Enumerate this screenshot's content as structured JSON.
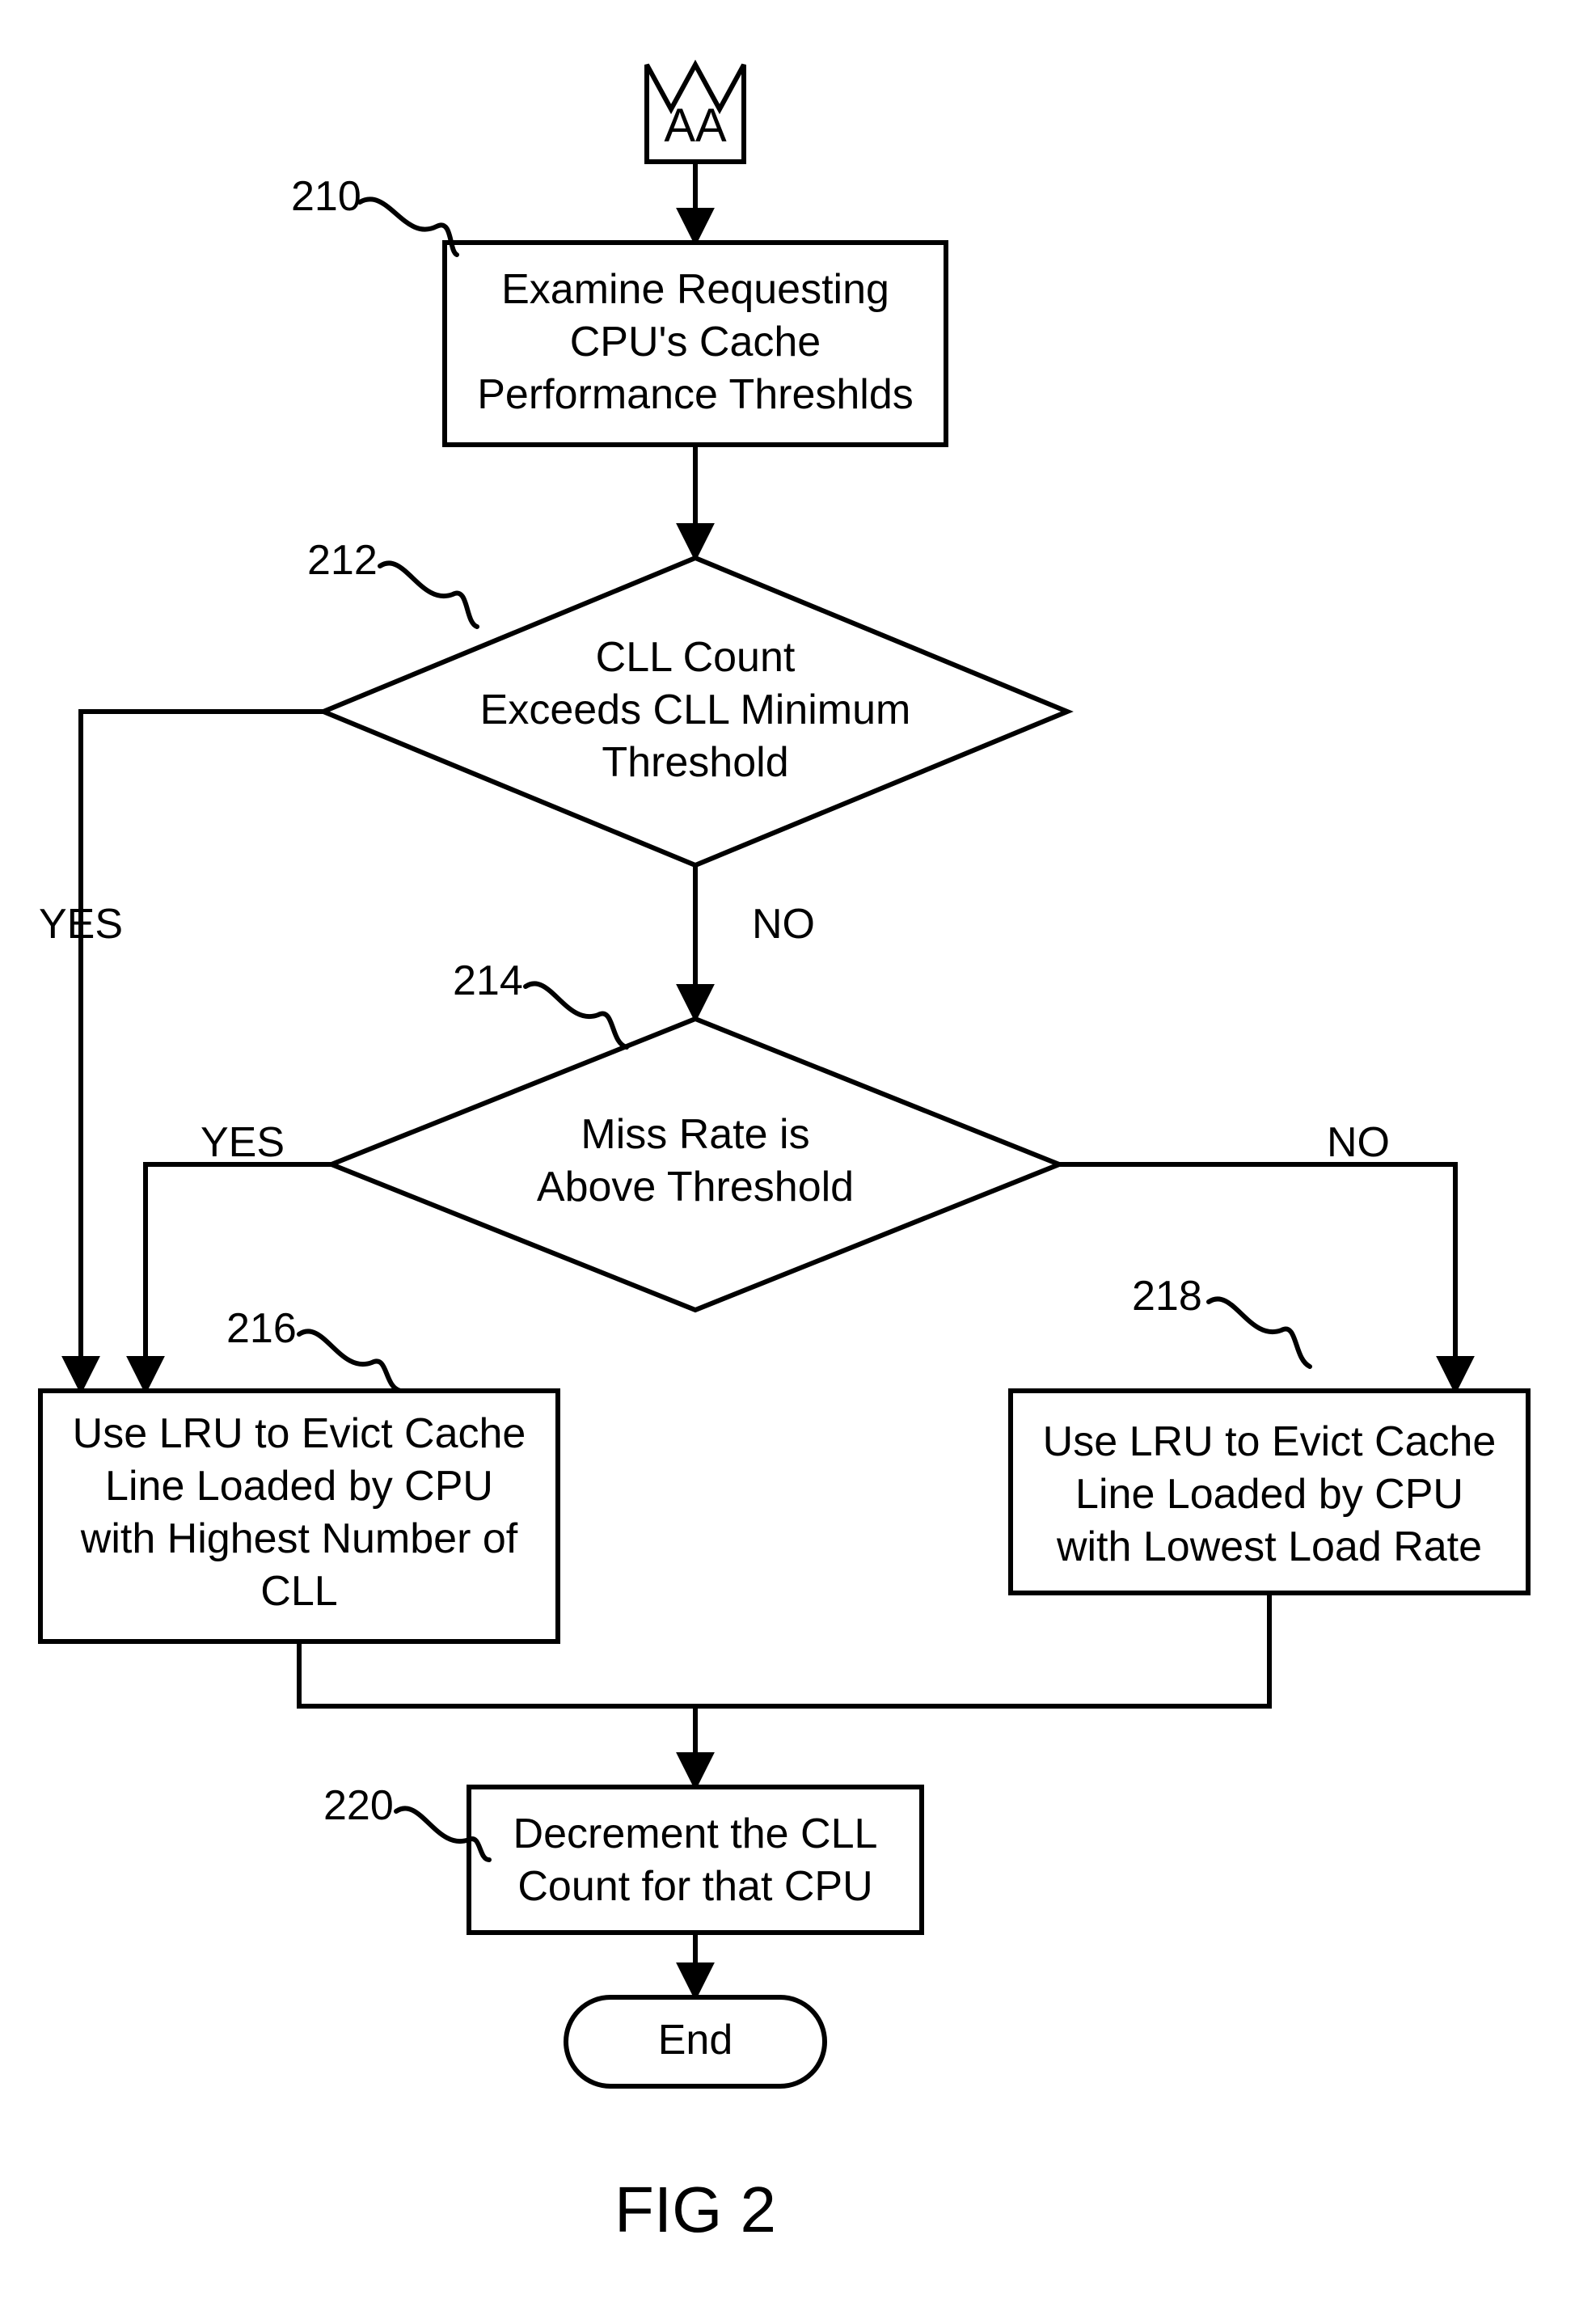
{
  "connector": {
    "label": "AA"
  },
  "refs": {
    "r210": "210",
    "r212": "212",
    "r214": "214",
    "r216": "216",
    "r218": "218",
    "r220": "220"
  },
  "nodes": {
    "n210": {
      "l1": "Examine Requesting",
      "l2": "CPU's Cache",
      "l3": "Performance Threshlds"
    },
    "n212": {
      "l1": "CLL Count",
      "l2": "Exceeds CLL Minimum",
      "l3": "Threshold"
    },
    "n214": {
      "l1": "Miss Rate is",
      "l2": "Above Threshold"
    },
    "n216": {
      "l1": "Use LRU to Evict Cache",
      "l2": "Line Loaded by CPU",
      "l3": "with Highest Number of",
      "l4": "CLL"
    },
    "n218": {
      "l1": "Use LRU to Evict Cache",
      "l2": "Line Loaded by CPU",
      "l3": "with Lowest Load Rate"
    },
    "n220": {
      "l1": "Decrement the CLL",
      "l2": "Count for that CPU"
    },
    "end": {
      "l1": "End"
    }
  },
  "edges": {
    "yes": "YES",
    "no": "NO"
  },
  "figure": "FIG 2"
}
